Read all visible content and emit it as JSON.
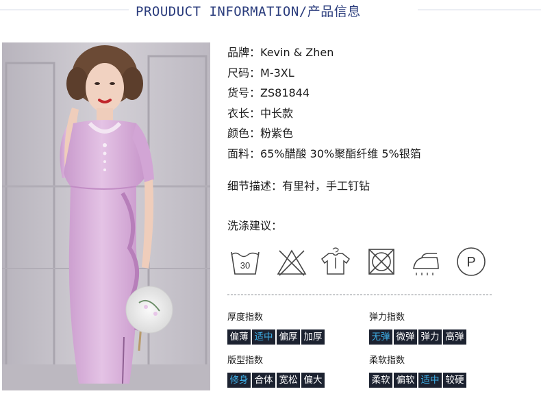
{
  "header": {
    "title": "PROUDUCT INFORMATION/产品信息"
  },
  "product": {
    "rows": [
      {
        "label": "品牌：",
        "value": "Kevin & Zhen"
      },
      {
        "label": "尺码：",
        "value": "M-3XL"
      },
      {
        "label": "货号：",
        "value": "ZS81844"
      },
      {
        "label": "衣长：",
        "value": "中长款"
      },
      {
        "label": "颜色：",
        "value": "粉紫色"
      },
      {
        "label": "面料：",
        "value": "65%醋酸 30%聚酯纤维 5%银箔"
      }
    ],
    "detail": "细节描述：有里衬，手工钉钻",
    "wash_title": "洗涤建议："
  },
  "care": {
    "wash_temp": "30",
    "dry_clean_letter": "P",
    "icons": [
      "wash-30-icon",
      "no-bleach-icon",
      "hang-dry-icon",
      "no-tumble-dry-icon",
      "iron-icon",
      "professional-dry-clean-icon"
    ]
  },
  "indices": {
    "thickness": {
      "title": "厚度指数",
      "options": [
        "偏薄",
        "适中",
        "偏厚",
        "加厚"
      ],
      "selected": 1
    },
    "elasticity": {
      "title": "弹力指数",
      "options": [
        "无弹",
        "微弹",
        "弹力",
        "高弹"
      ],
      "selected": 0
    },
    "fit": {
      "title": "版型指数",
      "options": [
        "修身",
        "合体",
        "宽松",
        "偏大"
      ],
      "selected": 0
    },
    "softness": {
      "title": "柔软指数",
      "options": [
        "柔软",
        "偏软",
        "适中",
        "较硬"
      ],
      "selected": 2
    }
  },
  "colors": {
    "title": "#2b3d7d",
    "chip_bg": "#1c2230",
    "chip_text": "#ffffff",
    "chip_active": "#3fb1ea",
    "dress": "#d9b2dc"
  }
}
